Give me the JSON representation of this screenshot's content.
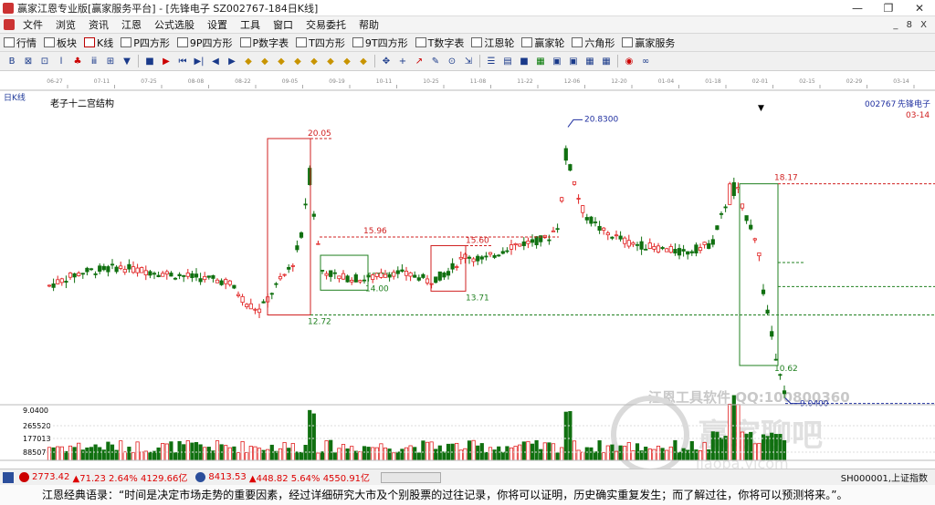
{
  "window": {
    "title": "赢家江恩专业版[赢家服务平台] - [先锋电子  SZ002767-184日K线]",
    "minimize": "—",
    "restore": "❐",
    "close": "✕",
    "mdi_controls": "_ 8 X"
  },
  "menu": [
    "文件",
    "浏览",
    "资讯",
    "江恩",
    "公式选股",
    "设置",
    "工具",
    "窗口",
    "交易委托",
    "帮助"
  ],
  "toolbar1": [
    {
      "icon": "grid-icon",
      "label": "行情"
    },
    {
      "icon": "block-icon",
      "label": "板块"
    },
    {
      "icon": "kline-icon",
      "label": "K线"
    },
    {
      "icon": "p-square-icon",
      "label": "P四方形"
    },
    {
      "icon": "9p-square-icon",
      "label": "9P四方形"
    },
    {
      "icon": "pn-square-icon",
      "label": "P数字表"
    },
    {
      "icon": "t-square-icon",
      "label": "T四方形"
    },
    {
      "icon": "9t-square-icon",
      "label": "9T四方形"
    },
    {
      "icon": "tn-square-icon",
      "label": "T数字表"
    },
    {
      "icon": "gann-wheel-icon",
      "label": "江恩轮"
    },
    {
      "icon": "winner-wheel-icon",
      "label": "赢家轮"
    },
    {
      "icon": "hexagon-icon",
      "label": "六角形"
    },
    {
      "icon": "dollar-icon",
      "label": "赢家服务"
    }
  ],
  "toolbar2": [
    "B",
    "⊠",
    "⊡",
    "ⅼ",
    "♣",
    "ⅲ",
    "⊞",
    "▼",
    "■",
    "▶",
    "⏮",
    "▶|",
    "◀",
    "▶",
    "◆",
    "◆",
    "◆",
    "◆",
    "◆",
    "◆",
    "◆",
    "◆",
    "✥",
    "+",
    "↗",
    "✎",
    "⊙",
    "⇲",
    "☰",
    "▤",
    "■",
    "▦",
    "▣",
    "▣",
    "▦",
    "▦",
    "◉",
    "∞"
  ],
  "chart": {
    "period_label": "日K线",
    "indicator_name": "老子十二宫结构",
    "stock_code": "002767",
    "stock_name": "先锋电子",
    "last_date": "03-14",
    "date_ticks": [
      "06-27",
      "07-11",
      "07-25",
      "08-08",
      "08-22",
      "09-05",
      "09-19",
      "10-11",
      "10-25",
      "11-08",
      "11-22",
      "12-06",
      "12-20",
      "01-04",
      "01-18",
      "02-01",
      "02-15",
      "02-29",
      "03-14"
    ],
    "price_labels": [
      {
        "text": "20.05",
        "color": "#d02020"
      },
      {
        "text": "12.72",
        "color": "#208020"
      },
      {
        "text": "15.96",
        "color": "#d02020"
      },
      {
        "text": "14.00",
        "color": "#208020"
      },
      {
        "text": "15.60",
        "color": "#d02020"
      },
      {
        "text": "13.71",
        "color": "#208020"
      },
      {
        "text": "20.8300",
        "color": "#2030a0"
      },
      {
        "text": "18.17",
        "color": "#d02020"
      },
      {
        "text": "10.62",
        "color": "#208020"
      },
      {
        "text": "9.0400",
        "color": "#2030a0"
      }
    ],
    "volume_axis": [
      "9.0400",
      "265520",
      "177013",
      "88507"
    ],
    "watermark_text": "江恩工具软件  QQ:100800360",
    "watermark_logo": "赢家聊吧",
    "watermark_url": "jiaoba.yjcom"
  },
  "status": {
    "sh_index": "2773.42",
    "sh_change": "▲71.23 2.64% 4129.66亿",
    "sz_index": "8413.53",
    "sz_change": "▲448.82 5.64% 4550.91亿",
    "scroll_label": "",
    "right_label": "SH000001,上证指数"
  },
  "quote": "江恩经典语录：“时间是决定市场走势的重要因素，经过详细研究大市及个别股票的过往记录，你将可以证明，历史确实重复发生；而了解过往，你将可以预测将来。”。"
}
